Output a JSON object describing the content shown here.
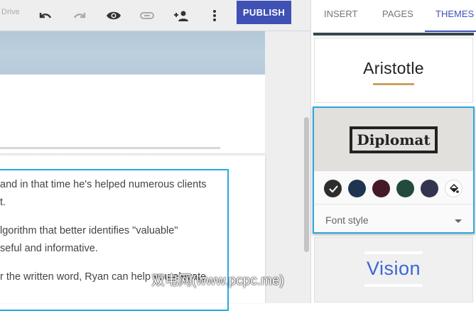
{
  "toolbar": {
    "drive_label": "Drive",
    "publish_label": "PUBLISH"
  },
  "document": {
    "paragraphs": [
      "and in that time he's helped numerous clients",
      "t.",
      "lgorithm that better identifies \"valuable\"",
      "seful and informative.",
      "r the written word, Ryan can help you elevate"
    ]
  },
  "watermark": "双电网(www.pcpc.me)",
  "panel": {
    "tabs": [
      {
        "label": "INSERT"
      },
      {
        "label": "PAGES"
      },
      {
        "label": "THEMES",
        "active": true
      }
    ],
    "themes": [
      {
        "name": "Aristotle"
      },
      {
        "name": "Diplomat",
        "selected": true,
        "swatches": [
          "#2d2d2d",
          "#1e3550",
          "#451a26",
          "#244a3e",
          "#33354f"
        ],
        "font_style_label": "Font style"
      },
      {
        "name": "Vision"
      }
    ]
  },
  "colors": {
    "accent": "#3f51b5",
    "selection": "#29a9e0",
    "aristotle_underline": "#c9a25e",
    "vision_text": "#3b66d6"
  }
}
